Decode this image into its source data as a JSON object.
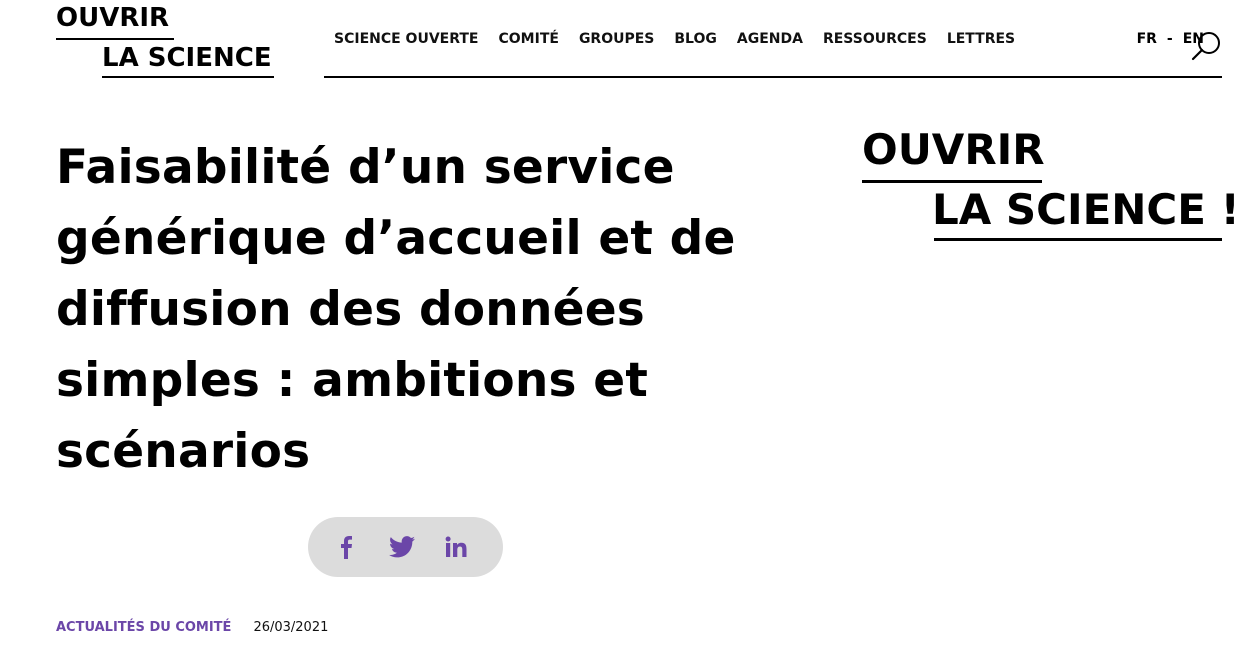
{
  "logo": {
    "line1": "OUVRIR",
    "line2": "LA SCIENCE"
  },
  "nav": {
    "items": [
      {
        "label": "SCIENCE OUVERTE"
      },
      {
        "label": "COMITÉ"
      },
      {
        "label": "GROUPES"
      },
      {
        "label": "BLOG"
      },
      {
        "label": "AGENDA"
      },
      {
        "label": "RESSOURCES"
      },
      {
        "label": "LETTRES"
      }
    ],
    "lang_fr": "FR",
    "lang_sep": "-",
    "lang_en": "EN",
    "search_icon": "search-icon"
  },
  "article": {
    "title": "Faisabilité d’un service générique d’accueil et de diffusion des données simples : ambitions et scénarios",
    "category": "ACTUALITÉS DU COMITÉ",
    "date": "26/03/2021"
  },
  "sidebar_logo": {
    "line1": "OUVRIR",
    "line2": "LA SCIENCE !"
  },
  "share": {
    "icons": [
      "facebook-icon",
      "twitter-icon",
      "linkedin-icon"
    ],
    "color": "#6b46a8",
    "background": "#dcdcdc"
  },
  "colors": {
    "accent": "#6b46a8",
    "text": "#000000"
  }
}
